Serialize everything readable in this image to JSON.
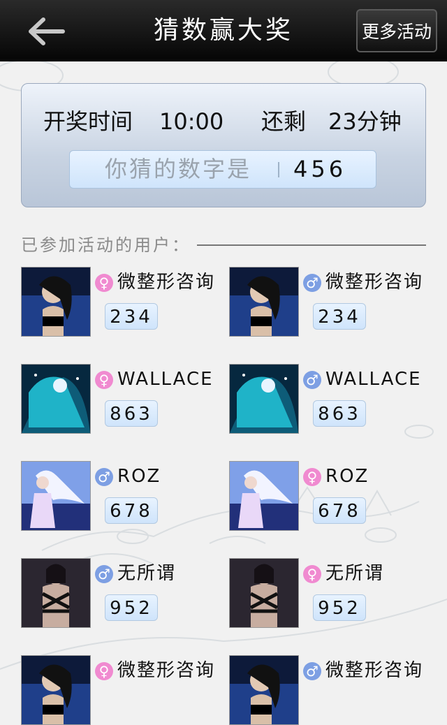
{
  "header": {
    "title": "猜数赢大奖",
    "back_icon": "arrow-left-icon",
    "more_label": "更多活动"
  },
  "draw": {
    "time_label": "开奖时间",
    "time_value": "10:00",
    "remain_label": "还剩",
    "remain_value": "23分钟"
  },
  "guess": {
    "label": "你猜的数字是",
    "value": "456"
  },
  "participants": {
    "title": "已参加活动的用户：",
    "rows": [
      [
        {
          "gender": "female",
          "gender_symbol": "♀",
          "name": "微整形咨询",
          "guess": "234",
          "avatar": "dark-hair-woman"
        },
        {
          "gender": "male",
          "gender_symbol": "♂",
          "name": "微整形咨询",
          "guess": "234",
          "avatar": "dark-hair-woman"
        }
      ],
      [
        {
          "gender": "female",
          "gender_symbol": "♀",
          "name": "WALLACE",
          "guess": "863",
          "avatar": "teal-anime-girl"
        },
        {
          "gender": "male",
          "gender_symbol": "♂",
          "name": "WALLACE",
          "guess": "863",
          "avatar": "teal-anime-girl"
        }
      ],
      [
        {
          "gender": "male",
          "gender_symbol": "♂",
          "name": "ROZ",
          "guess": "678",
          "avatar": "white-hair-fantasy"
        },
        {
          "gender": "female",
          "gender_symbol": "♀",
          "name": "ROZ",
          "guess": "678",
          "avatar": "white-hair-fantasy"
        }
      ],
      [
        {
          "gender": "male",
          "gender_symbol": "♂",
          "name": "无所谓",
          "guess": "952",
          "avatar": "dark-fantasy-woman"
        },
        {
          "gender": "female",
          "gender_symbol": "♀",
          "name": "无所谓",
          "guess": "952",
          "avatar": "dark-fantasy-woman"
        }
      ],
      [
        {
          "gender": "female",
          "gender_symbol": "♀",
          "name": "微整形咨询",
          "guess": "",
          "avatar": "dark-hair-woman"
        },
        {
          "gender": "male",
          "gender_symbol": "♂",
          "name": "微整形咨询",
          "guess": "",
          "avatar": "dark-hair-woman"
        }
      ]
    ]
  },
  "colors": {
    "female": "#f08ad0",
    "male": "#7d9fe3",
    "card_bg": "#c8d3e2"
  }
}
